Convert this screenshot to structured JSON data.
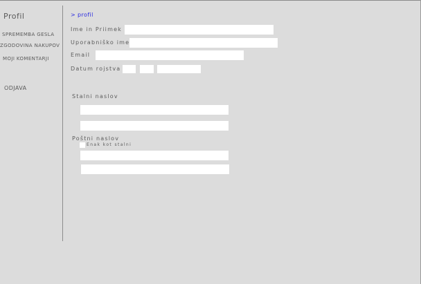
{
  "sidebar": {
    "title": "Profil",
    "items": [
      {
        "label": "SPREMEMBA GESLA"
      },
      {
        "label": "ZGODOVINA NAKUPOV"
      },
      {
        "label": "MOJI KOMENTARJI"
      }
    ],
    "logout_label": "ODJAVA"
  },
  "breadcrumb": "> profil",
  "form": {
    "full_name_label": "Ime in Priimek",
    "full_name_value": "",
    "username_label": "Uporabniško ime",
    "username_value": "",
    "email_label": "Email",
    "email_value": "",
    "dob_label": "Datum rojstva",
    "dob_day": "",
    "dob_month": "",
    "dob_year": "",
    "permanent_address_label": "Stalni naslov",
    "permanent_address_line1": "",
    "permanent_address_line2": "",
    "postal_address_label": "Poštni naslov",
    "same_as_permanent_label": "Enak kot stalni",
    "postal_address_line1": "",
    "postal_address_line2": ""
  }
}
